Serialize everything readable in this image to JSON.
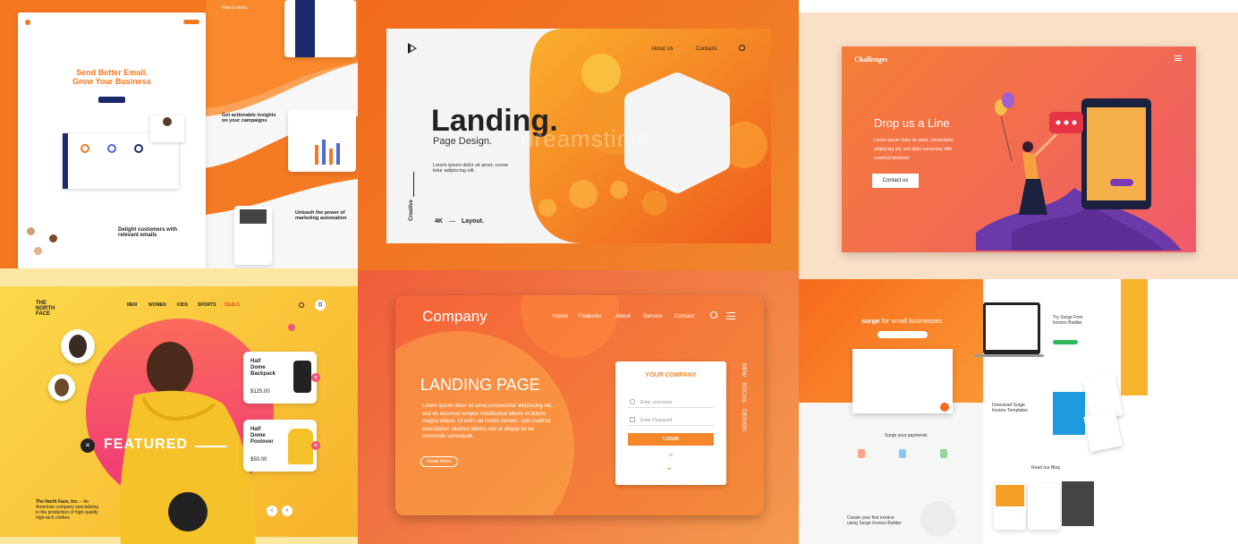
{
  "p1": {
    "hero_title_line1": "Send Better Email.",
    "hero_title_line2": "Grow Your Business",
    "how_it_works": "How it works",
    "insights_title_line1": "Get actionable insights",
    "insights_title_line2": "on your campaigns",
    "delight_title_line1": "Delight customers with",
    "delight_title_line2": "relevant emails",
    "unleash_title_line1": "Unleash the power of",
    "unleash_title_line2": "marketing automation"
  },
  "p2": {
    "nav_about": "About Us",
    "nav_contacts": "Contacts",
    "title": "Landing.",
    "subtitle": "Page Design.",
    "body_line1": "Lorem ipsum dolor sit amet, conse",
    "body_line2": "tetur adipiscing elit.",
    "vertical_label": "Creative",
    "footer_4k": "4K",
    "footer_dash": "—",
    "footer_layout": "Layout.",
    "watermark": "dreamstime."
  },
  "p3": {
    "brand": "Challenges",
    "title": "Drop us a Line",
    "body_line1": "Lorem ipsum dolor sit amet, consectetur",
    "body_line2": "adipiscing elit, sed diam nonummy nibh",
    "body_line3": "euismod tincidunt.",
    "cta": "Contact us"
  },
  "p4": {
    "logo_line1": "THE",
    "logo_line2": "NORTH",
    "logo_line3": "FACE",
    "nav": [
      "MEN",
      "WOMEN",
      "KIDS",
      "SPORTS",
      "DEALS"
    ],
    "featured": "FEATURED",
    "product1_name_line1": "Half",
    "product1_name_line2": "Dome",
    "product1_name_line3": "Backpack",
    "product1_price": "$125.00",
    "product2_name_line1": "Half",
    "product2_name_line2": "Dome",
    "product2_name_line3": "Poolover",
    "product2_price": "$50.00",
    "about_brand": "The North Face, Inc.",
    "about_text1": " – An",
    "about_text2": "American company specializing",
    "about_text3": "in the production of high-quality",
    "about_text4": "high-tech clothes."
  },
  "p5": {
    "brand": "Company",
    "nav": [
      "Home",
      "Features",
      "About",
      "Service",
      "Contact"
    ],
    "title": "LANDING PAGE",
    "body_line1": "Lorem ipsum dolor sit amet,consectetur adipisicing elit,",
    "body_line2": "sed do eiusmod tempor incididuntut labore et dolore",
    "body_line3": "magna aliqua. Ut enim ad minim veniam, quis nodtrud",
    "body_line4": "exercitation ullamco laboris nisi ut aliquip ex ea",
    "body_line5": "commodo consequat.",
    "read_more": "Read More",
    "form_title": "YOUR COMPANY",
    "username_placeholder": "Enter username",
    "password_placeholder": "Enter Password",
    "login": "LOGIN",
    "or": "or",
    "vertical_line1": "NEW",
    "vertical_line2": "SOCIAL",
    "vertical_line3": "DESIGN"
  },
  "p6": {
    "hero_title_brand": "surge",
    "hero_title_rest": " for small businesses",
    "try_line1": "Try Surge Free",
    "try_line2": "Invoice Builder",
    "download_line1": "Download Surge",
    "download_line2": "Invoice Templates",
    "payments": "Surge your payments",
    "blog": "Read our Blog",
    "invoice_line1": "Create your first invoice",
    "invoice_line2": "using Surge Invoice Builder"
  }
}
